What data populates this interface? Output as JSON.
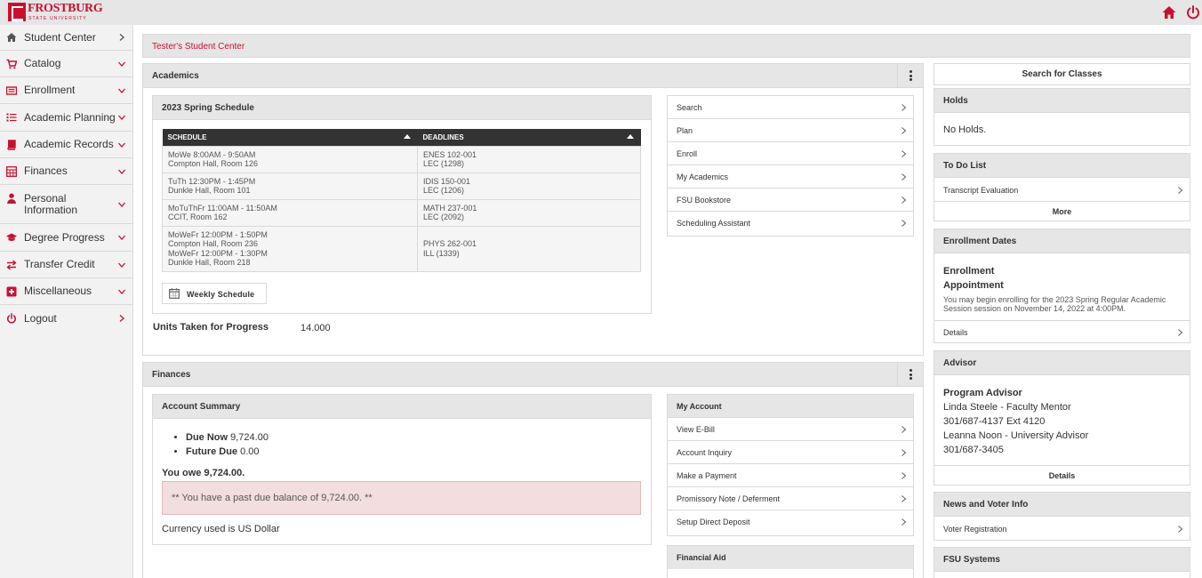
{
  "brand": {
    "name": "FROSTBURG",
    "tagline": "STATE UNIVERSITY",
    "accent": "#c8102e"
  },
  "sidebar": {
    "items": [
      {
        "label": "Student Center",
        "icon": "home-icon"
      },
      {
        "label": "Catalog",
        "icon": "cart-icon"
      },
      {
        "label": "Enrollment",
        "icon": "id-card-icon"
      },
      {
        "label": "Academic Planning",
        "icon": "list-icon"
      },
      {
        "label": "Academic Records",
        "icon": "book-icon"
      },
      {
        "label": "Finances",
        "icon": "calculator-icon"
      },
      {
        "label": "Personal Information",
        "icon": "user-icon"
      },
      {
        "label": "Degree Progress",
        "icon": "graduation-cap-icon"
      },
      {
        "label": "Transfer Credit",
        "icon": "exchange-icon"
      },
      {
        "label": "Miscellaneous",
        "icon": "plus-square-icon"
      },
      {
        "label": "Logout",
        "icon": "power-icon"
      }
    ]
  },
  "breadcrumb": "Tester's Student Center",
  "academics": {
    "title": "Academics",
    "schedule_title": "2023 Spring Schedule",
    "headers": {
      "schedule": "SCHEDULE",
      "deadlines": "DEADLINES"
    },
    "rows": [
      {
        "s1": "MoWe 8:00AM - 9:50AM",
        "s2": "Compton Hall, Room 126",
        "s3": "",
        "s4": "",
        "d1": "ENES 102-001",
        "d2": "LEC (1298)"
      },
      {
        "s1": "TuTh 12:30PM - 1:45PM",
        "s2": "Dunkle Hall, Room 101",
        "s3": "",
        "s4": "",
        "d1": "IDIS 150-001",
        "d2": "LEC (1206)"
      },
      {
        "s1": "MoTuThFr 11:00AM - 11:50AM",
        "s2": "CCIT, Room 162",
        "s3": "",
        "s4": "",
        "d1": "MATH 237-001",
        "d2": "LEC (2092)"
      },
      {
        "s1": "MoWeFr 12:00PM - 1:50PM",
        "s2": "Compton Hall, Room 236",
        "s3": "MoWeFr 12:00PM - 1:30PM",
        "s4": "Dunkle Hall, Room 218",
        "d1": "PHYS 262-001",
        "d2": "ILL (1339)"
      }
    ],
    "weekly_schedule_btn": "Weekly Schedule",
    "units_label": "Units Taken for Progress",
    "units_value": "14.000",
    "links": [
      "Search",
      "Plan",
      "Enroll",
      "My Academics",
      "FSU Bookstore",
      "Scheduling Assistant"
    ]
  },
  "finances": {
    "title": "Finances",
    "summary_title": "Account Summary",
    "due_now_label": "Due Now",
    "due_now_value": "9,724.00",
    "future_due_label": "Future Due",
    "future_due_value": "0.00",
    "you_owe": "You owe 9,724.00.",
    "alert": "** You have a past due balance of 9,724.00. **",
    "currency": "Currency used is US Dollar",
    "my_account_title": "My Account",
    "my_account_links": [
      "View E-Bill",
      "Account Inquiry",
      "Make a Payment",
      "Promissory Note / Deferment",
      "Setup Direct Deposit"
    ],
    "financial_aid_title": "Financial Aid"
  },
  "right": {
    "search_classes": "Search for Classes",
    "holds_title": "Holds",
    "holds_text": "No Holds.",
    "todo_title": "To Do List",
    "todo_item": "Transcript Evaluation",
    "more": "More",
    "enroll_dates_title": "Enrollment Dates",
    "enroll_heading1": "Enrollment",
    "enroll_heading2": "Appointment",
    "enroll_text": "You may begin enrolling for the 2023 Spring Regular Academic Session session on November 14, 2022 at 4:00PM.",
    "details": "Details",
    "advisor_title": "Advisor",
    "advisor_heading": "Program Advisor",
    "advisor_lines": [
      "Linda Steele - Faculty Mentor",
      "301/687-4137 Ext 4120",
      "Leanna Noon - University Advisor",
      "301/687-3405"
    ],
    "news_title": "News and Voter Info",
    "voter": "Voter Registration",
    "fsu_systems_title": "FSU Systems"
  }
}
